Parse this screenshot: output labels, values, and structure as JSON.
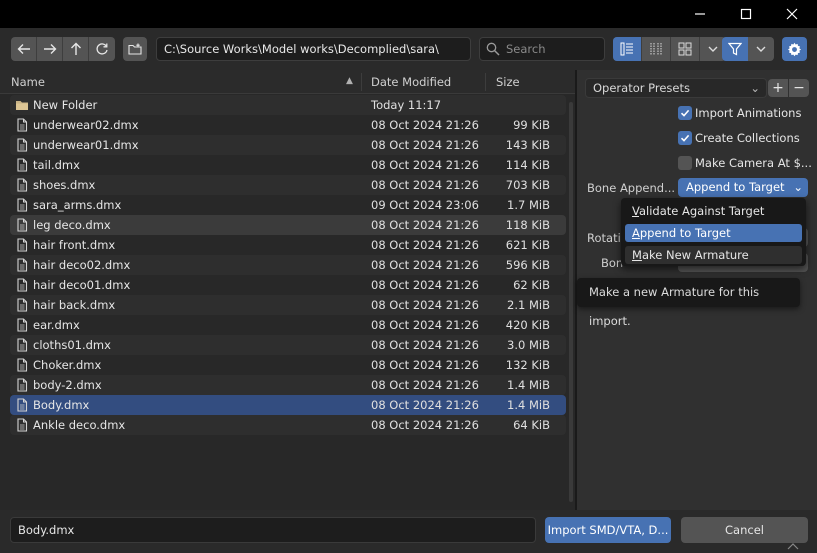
{
  "window": {
    "controls": {
      "minimize": "minimize-icon",
      "maximize": "maximize-icon",
      "close": "close-icon"
    }
  },
  "toolbar": {
    "nav_icons": [
      "back-arrow-icon",
      "forward-arrow-icon",
      "parent-directory-icon",
      "refresh-icon"
    ],
    "new_folder_icon": "new-folder-icon",
    "path": "C:\\Source Works\\Model works\\Decomplied\\sara\\",
    "search_placeholder": "Search",
    "view_modes": [
      "vertical-list-icon",
      "horizontal-list-icon",
      "thumbnails-icon"
    ],
    "active_view_mode": "vertical-list-icon"
  },
  "file_list": {
    "columns": {
      "name": "Name",
      "date": "Date Modified",
      "size": "Size"
    },
    "sort": "Name ascending",
    "rows": [
      {
        "name": "New Folder",
        "date": "Today 11:17",
        "size": "",
        "type": "folder"
      },
      {
        "name": "underwear02.dmx",
        "date": "08 Oct 2024 21:26",
        "size": "99 KiB",
        "type": "file"
      },
      {
        "name": "underwear01.dmx",
        "date": "08 Oct 2024 21:26",
        "size": "143 KiB",
        "type": "file"
      },
      {
        "name": "tail.dmx",
        "date": "08 Oct 2024 21:26",
        "size": "114 KiB",
        "type": "file"
      },
      {
        "name": "shoes.dmx",
        "date": "08 Oct 2024 21:26",
        "size": "703 KiB",
        "type": "file"
      },
      {
        "name": "sara_arms.dmx",
        "date": "09 Oct 2024 23:06",
        "size": "1.7 MiB",
        "type": "file"
      },
      {
        "name": "leg deco.dmx",
        "date": "08 Oct 2024 21:26",
        "size": "118 KiB",
        "type": "file",
        "state": "hover"
      },
      {
        "name": "hair front.dmx",
        "date": "08 Oct 2024 21:26",
        "size": "621 KiB",
        "type": "file"
      },
      {
        "name": "hair deco02.dmx",
        "date": "08 Oct 2024 21:26",
        "size": "596 KiB",
        "type": "file"
      },
      {
        "name": "hair deco01.dmx",
        "date": "08 Oct 2024 21:26",
        "size": "62 KiB",
        "type": "file"
      },
      {
        "name": "hair back.dmx",
        "date": "08 Oct 2024 21:26",
        "size": "2.1 MiB",
        "type": "file"
      },
      {
        "name": "ear.dmx",
        "date": "08 Oct 2024 21:26",
        "size": "420 KiB",
        "type": "file"
      },
      {
        "name": "cloths01.dmx",
        "date": "08 Oct 2024 21:26",
        "size": "3.0 MiB",
        "type": "file"
      },
      {
        "name": "Choker.dmx",
        "date": "08 Oct 2024 21:26",
        "size": "132 KiB",
        "type": "file"
      },
      {
        "name": "body-2.dmx",
        "date": "08 Oct 2024 21:26",
        "size": "1.4 MiB",
        "type": "file"
      },
      {
        "name": "Body.dmx",
        "date": "08 Oct 2024 21:26",
        "size": "1.4 MiB",
        "type": "file",
        "state": "selected"
      },
      {
        "name": "Ankle deco.dmx",
        "date": "08 Oct 2024 21:26",
        "size": "64 KiB",
        "type": "file"
      }
    ]
  },
  "side_panel": {
    "operator_presets": "Operator Presets",
    "checkboxes": [
      {
        "label": "Import Animations",
        "checked": true
      },
      {
        "label": "Create Collections",
        "checked": true
      },
      {
        "label": "Make Camera At $...",
        "checked": false
      }
    ],
    "bone_append_label": "Bone Append...",
    "bone_append_value": "Append to Target",
    "rotation_label_partial": "Rotati",
    "bone_label_partial": "Bon"
  },
  "dropdown": {
    "items": [
      "Validate Against Target",
      "Append to Target",
      "Make New Armature"
    ],
    "current": "Append to Target",
    "hovered": "Make New Armature",
    "tooltip": "Make a new Armature for this import."
  },
  "bottom": {
    "filename": "Body.dmx",
    "import_label": "Import SMD/VTA, D...",
    "cancel_label": "Cancel"
  },
  "colors": {
    "accent": "#4772b3",
    "selected_row": "#334d80",
    "background": "#282828",
    "panel": "#303030"
  }
}
